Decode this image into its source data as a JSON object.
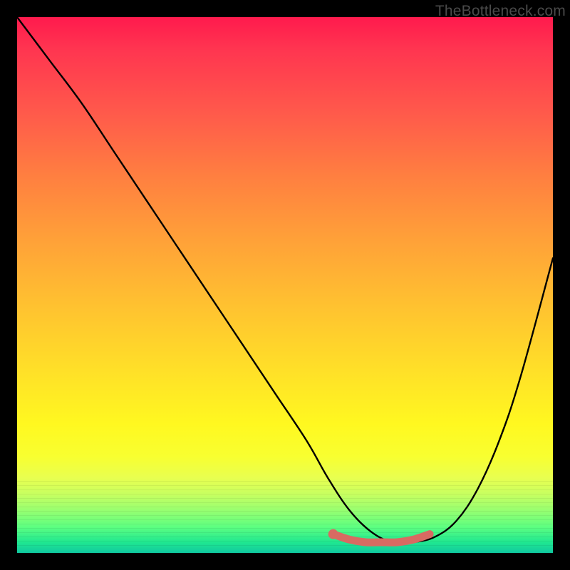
{
  "watermark": "TheBottleneck.com",
  "chart_data": {
    "type": "line",
    "title": "",
    "xlabel": "",
    "ylabel": "",
    "xlim": [
      0,
      100
    ],
    "ylim": [
      0,
      100
    ],
    "grid": false,
    "series": [
      {
        "name": "curve",
        "color": "#000000",
        "x": [
          0,
          6,
          12,
          18,
          24,
          30,
          36,
          42,
          48,
          54,
          58,
          62,
          66,
          70,
          74,
          78,
          82,
          86,
          90,
          94,
          100
        ],
        "values": [
          100,
          92,
          84,
          75,
          66,
          57,
          48,
          39,
          30,
          21,
          14,
          8,
          4,
          2,
          2,
          3,
          6,
          12,
          21,
          33,
          55
        ]
      },
      {
        "name": "highlight",
        "color": "#d86a62",
        "x": [
          59,
          62,
          65,
          68,
          71,
          74,
          77
        ],
        "values": [
          3.5,
          2.5,
          2.0,
          2.0,
          2.0,
          2.5,
          3.5
        ]
      }
    ]
  }
}
